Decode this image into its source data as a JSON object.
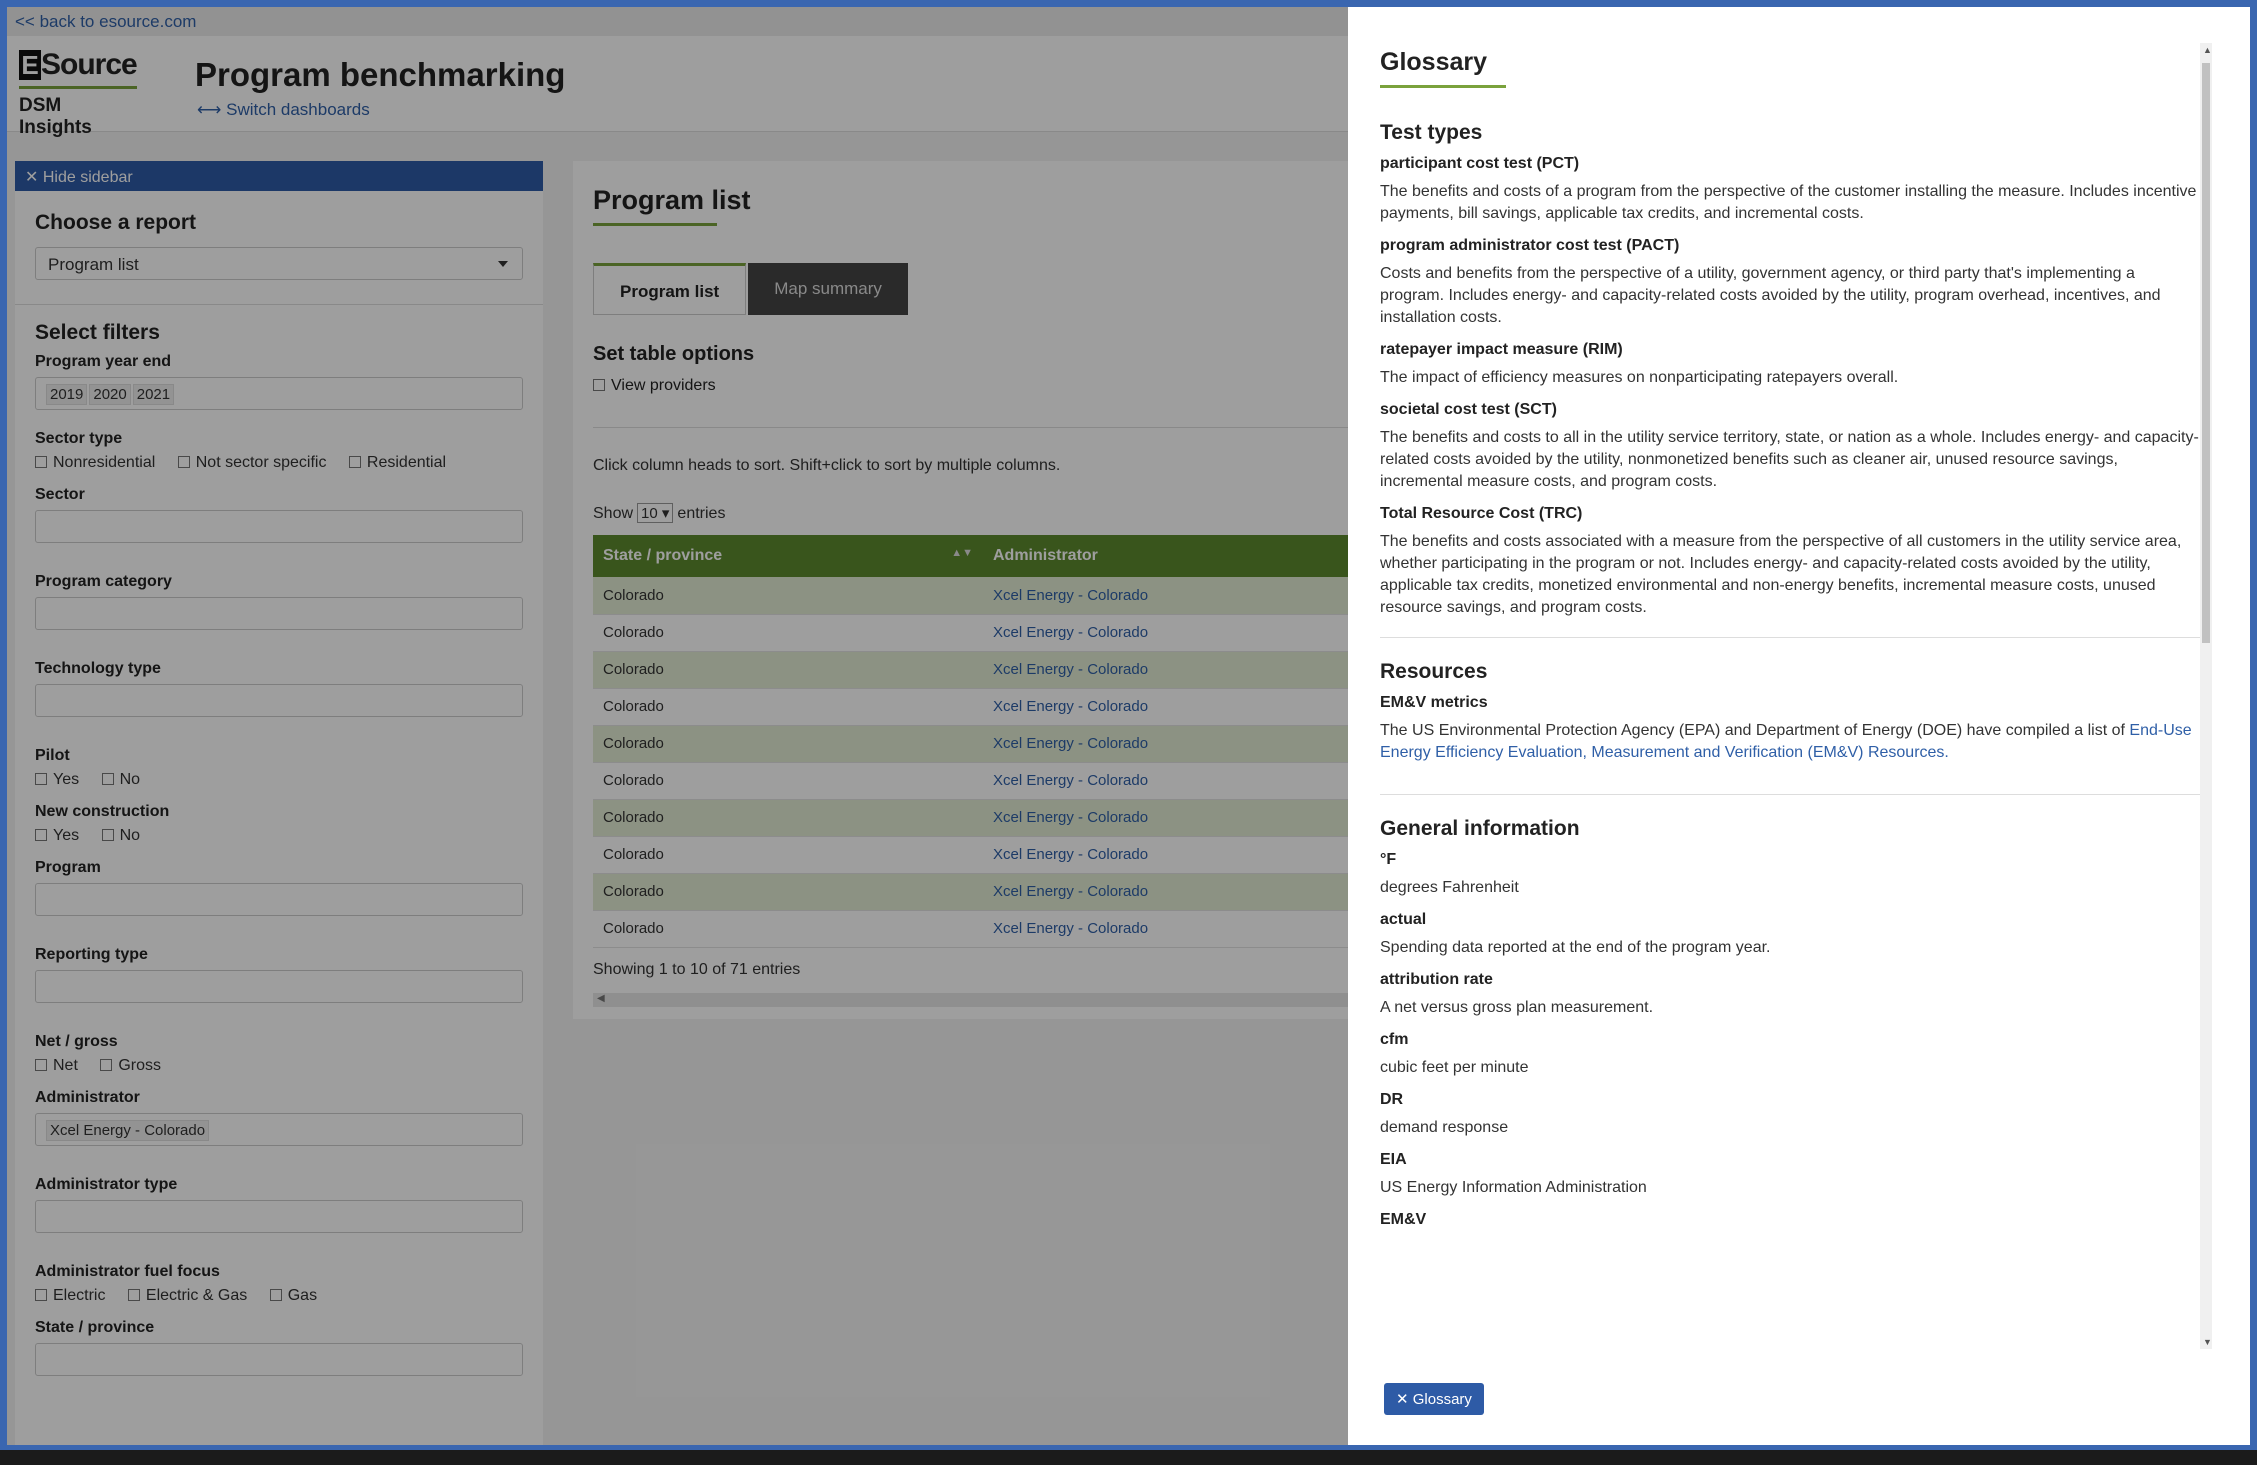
{
  "topbar": {
    "back_link": "<< back to esource.com"
  },
  "header": {
    "logo_mark": "E",
    "logo_word": "Source",
    "logo_sub": "DSM Insights",
    "title": "Program benchmarking",
    "switch_link": "Switch dashboards"
  },
  "sidebar": {
    "hide_label": "Hide sidebar",
    "choose_report_heading": "Choose a report",
    "report_select_value": "Program list",
    "filters_heading": "Select filters",
    "program_year_end": {
      "label": "Program year end",
      "values": [
        "2019",
        "2020",
        "2021"
      ]
    },
    "sector_type": {
      "label": "Sector type",
      "options": [
        "Nonresidential",
        "Not sector specific",
        "Residential"
      ]
    },
    "sector_label": "Sector",
    "program_category_label": "Program category",
    "technology_type_label": "Technology type",
    "pilot": {
      "label": "Pilot",
      "options": [
        "Yes",
        "No"
      ]
    },
    "new_construction": {
      "label": "New construction",
      "options": [
        "Yes",
        "No"
      ]
    },
    "program_label": "Program",
    "reporting_type_label": "Reporting type",
    "net_gross": {
      "label": "Net / gross",
      "options": [
        "Net",
        "Gross"
      ]
    },
    "administrator": {
      "label": "Administrator",
      "value": "Xcel Energy - Colorado"
    },
    "administrator_type_label": "Administrator type",
    "admin_fuel_focus": {
      "label": "Administrator fuel focus",
      "options": [
        "Electric",
        "Electric & Gas",
        "Gas"
      ]
    },
    "state_province_label": "State / province"
  },
  "main": {
    "title": "Program list",
    "tabs": [
      {
        "label": "Program list"
      },
      {
        "label": "Map summary"
      }
    ],
    "set_table_options": "Set table options",
    "view_providers": "View providers",
    "sort_hint": "Click column heads to sort. Shift+click to sort by multiple columns.",
    "show_label": "Show",
    "show_value": "10",
    "entries_label": "entries",
    "table": {
      "columns": [
        "State / province",
        "Administrator"
      ],
      "rows": [
        [
          "Colorado",
          "Xcel Energy - Colorado"
        ],
        [
          "Colorado",
          "Xcel Energy - Colorado"
        ],
        [
          "Colorado",
          "Xcel Energy - Colorado"
        ],
        [
          "Colorado",
          "Xcel Energy - Colorado"
        ],
        [
          "Colorado",
          "Xcel Energy - Colorado"
        ],
        [
          "Colorado",
          "Xcel Energy - Colorado"
        ],
        [
          "Colorado",
          "Xcel Energy - Colorado"
        ],
        [
          "Colorado",
          "Xcel Energy - Colorado"
        ],
        [
          "Colorado",
          "Xcel Energy - Colorado"
        ],
        [
          "Colorado",
          "Xcel Energy - Colorado"
        ]
      ]
    },
    "showing": "Showing 1 to 10 of 71 entries"
  },
  "glossary": {
    "title": "Glossary",
    "sections": {
      "test_types": {
        "heading": "Test types",
        "items": [
          {
            "term": "participant cost test (PCT)",
            "def": "The benefits and costs of a program from the perspective of the customer installing the measure. Includes incentive payments, bill savings, applicable tax credits, and incremental costs."
          },
          {
            "term": "program administrator cost test (PACT)",
            "def": "Costs and benefits from the perspective of a utility, government agency, or third party that's implementing a program. Includes energy- and capacity-related costs avoided by the utility, program overhead, incentives, and installation costs."
          },
          {
            "term": "ratepayer impact measure (RIM)",
            "def": "The impact of efficiency measures on nonparticipating ratepayers overall."
          },
          {
            "term": "societal cost test (SCT)",
            "def": "The benefits and costs to all in the utility service territory, state, or nation as a whole. Includes energy- and capacity-related costs avoided by the utility, nonmonetized benefits such as cleaner air, unused resource savings, incremental measure costs, and program costs."
          },
          {
            "term": "Total Resource Cost (TRC)",
            "def": "The benefits and costs associated with a measure from the perspective of all customers in the utility service area, whether participating in the program or not. Includes energy- and capacity-related costs avoided by the utility, applicable tax credits, monetized environmental and non-energy benefits, incremental measure costs, unused resource savings, and program costs."
          }
        ]
      },
      "resources": {
        "heading": "Resources",
        "term": "EM&V metrics",
        "def_prefix": "The US Environmental Protection Agency (EPA) and Department of Energy (DOE) have compiled a list of ",
        "link": "End-Use Energy Efficiency Evaluation, Measurement and Verification (EM&V) Resources."
      },
      "general": {
        "heading": "General information",
        "items": [
          {
            "term": "°F",
            "def": "degrees Fahrenheit"
          },
          {
            "term": "actual",
            "def": "Spending data reported at the end of the program year."
          },
          {
            "term": "attribution rate",
            "def": "A net versus gross plan measurement."
          },
          {
            "term": "cfm",
            "def": "cubic feet per minute"
          },
          {
            "term": "DR",
            "def": "demand response"
          },
          {
            "term": "EIA",
            "def": "US Energy Information Administration"
          },
          {
            "term": "EM&V",
            "def": ""
          }
        ]
      }
    },
    "close_button": "Glossary"
  },
  "colors": {
    "accent_green": "#7aa23c",
    "table_header": "#5d8a2e",
    "brand_blue": "#2e5ba6",
    "link": "#2f5fa7"
  }
}
